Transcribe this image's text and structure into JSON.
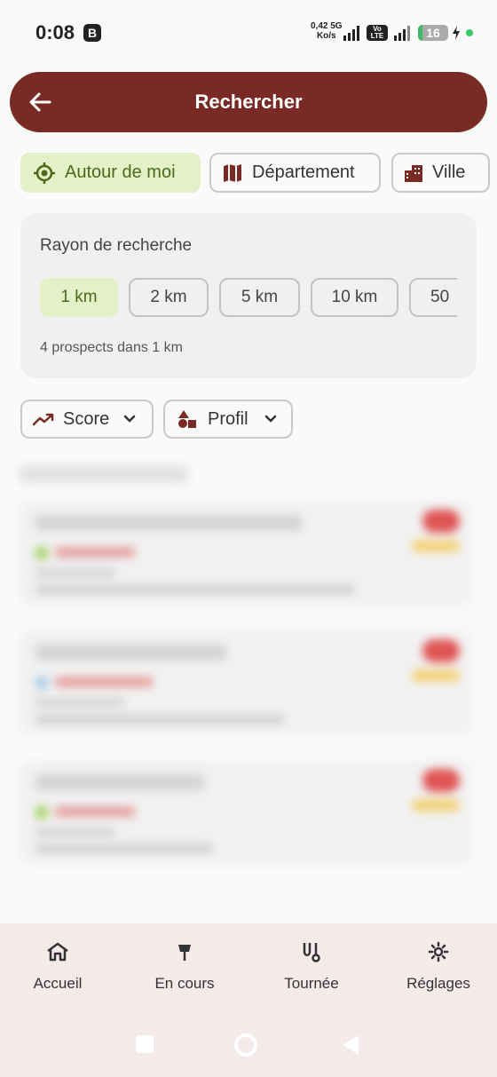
{
  "status_bar": {
    "time": "0:08",
    "notification_badge": "B",
    "net_speed_value": "0,42",
    "net_speed_unit": "Ko/s",
    "network_type": "5G",
    "volte_top": "Vo",
    "volte_bottom": "LTE",
    "battery": "16"
  },
  "header": {
    "title": "Rechercher",
    "back_icon": "arrow-left-icon",
    "color": "#7a2a25"
  },
  "mode_tabs": [
    {
      "label": "Autour de moi",
      "icon": "location-target-icon",
      "active": true
    },
    {
      "label": "Département",
      "icon": "map-icon",
      "active": false
    },
    {
      "label": "Ville",
      "icon": "city-icon",
      "active": false
    }
  ],
  "radius": {
    "title": "Rayon de recherche",
    "options": [
      "1 km",
      "2 km",
      "5 km",
      "10 km",
      "50"
    ],
    "selected": "1 km",
    "summary": "4 prospects dans 1 km"
  },
  "filters": [
    {
      "label": "Score",
      "icon": "trending-up-icon"
    },
    {
      "label": "Profil",
      "icon": "shapes-icon"
    }
  ],
  "bottom_nav": [
    {
      "label": "Accueil",
      "icon": "home-icon"
    },
    {
      "label": "En cours",
      "icon": "pin-icon"
    },
    {
      "label": "Tournée",
      "icon": "route-icon"
    },
    {
      "label": "Réglages",
      "icon": "gear-icon"
    }
  ],
  "colors": {
    "accent": "#7a2a25",
    "active_chip_bg": "#e3f0c8",
    "active_chip_text": "#4a6a1a"
  }
}
